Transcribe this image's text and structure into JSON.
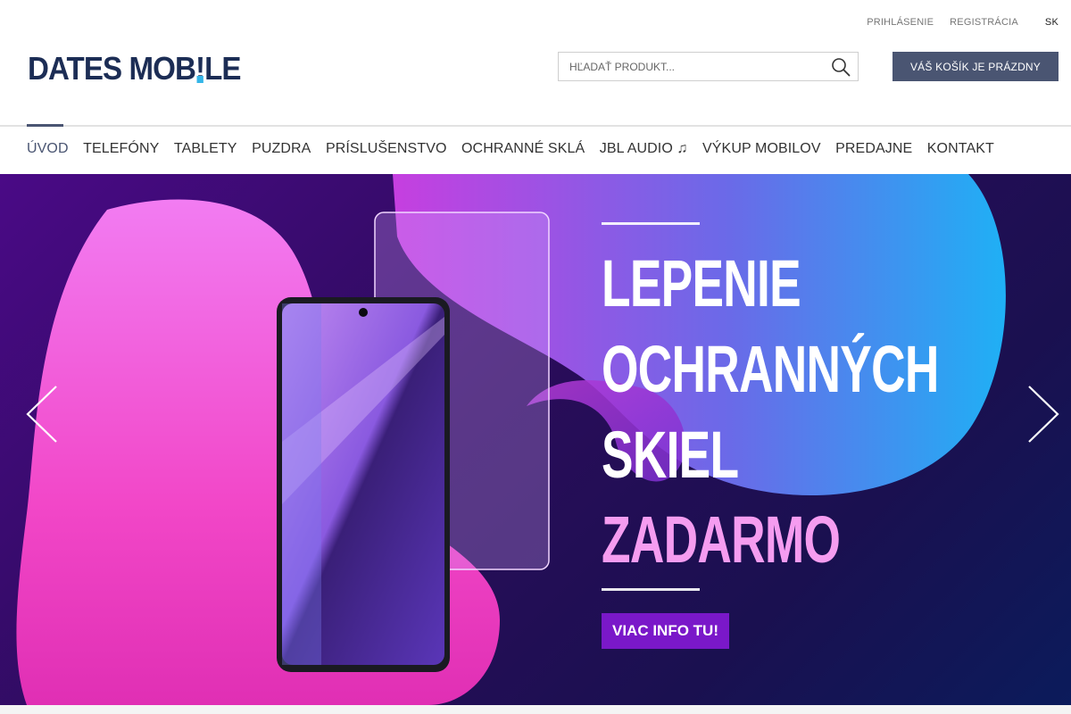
{
  "header": {
    "links": {
      "login": "PRIHLÁSENIE",
      "register": "REGISTRÁCIA",
      "language": "SK"
    },
    "logo": {
      "part1": "DATES MOB",
      "bang": "!",
      "part2": "LE"
    },
    "search": {
      "placeholder": "HĽADAŤ PRODUKT...",
      "value": ""
    },
    "cart_label": "VÁŠ KOŠÍK JE PRÁZDNY"
  },
  "nav": {
    "items": [
      {
        "label": "ÚVOD"
      },
      {
        "label": "TELEFÓNY"
      },
      {
        "label": "TABLETY"
      },
      {
        "label": "PUZDRA"
      },
      {
        "label": "PRÍSLUŠENSTVO"
      },
      {
        "label": "OCHRANNÉ SKLÁ"
      },
      {
        "label": "JBL AUDIO ♫"
      },
      {
        "label": "VÝKUP MOBILOV"
      },
      {
        "label": "PREDAJNE"
      },
      {
        "label": "KONTAKT"
      }
    ]
  },
  "banner": {
    "headline_lines": [
      "LEPENIE",
      "OCHRANNÝCH",
      "SKIEL",
      "ZADARMO"
    ],
    "cta_label": "VIAC INFO TU!"
  },
  "colors": {
    "brand_navy": "#1c2d55",
    "brand_accent": "#35b6e8",
    "cart_bg": "#4a5572",
    "cta_bg": "#7a18c9",
    "headline_pink": "#f59cf0"
  },
  "icons": {
    "search": "search-icon",
    "prev": "chevron-left-icon",
    "next": "chevron-right-icon"
  }
}
